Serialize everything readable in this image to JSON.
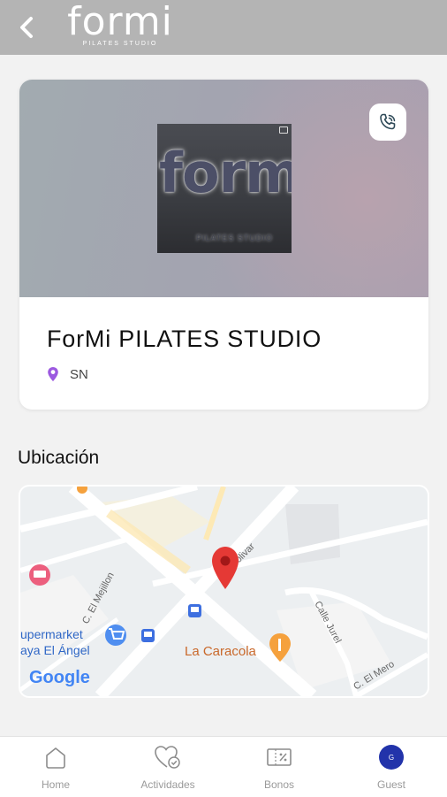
{
  "header": {
    "back_icon": "chevron-left-icon",
    "logo_word": "formi",
    "logo_sub": "PILATES STUDIO"
  },
  "studio": {
    "photo_word": "formi",
    "photo_sub": "PILATES STUDIO",
    "call_icon": "phone-call-icon",
    "name": "ForMi PILATES STUDIO",
    "location_icon": "location-pin-icon",
    "location": "SN",
    "accent_color": "#9c59e0"
  },
  "location_section": {
    "title": "Ubicación"
  },
  "map": {
    "labels": {
      "street_bolivar": "Bolivar",
      "street_mejillon": "C. El Mejillon",
      "street_jurel": "Calle Jurel",
      "street_mero": "C. El Mero",
      "supermarket_line1": "upermarket",
      "supermarket_line2": "aya El Ángel",
      "restaurant": "La Caracola",
      "google": "Google"
    },
    "pin_color": "#e53935"
  },
  "nav": {
    "items": [
      {
        "label": "Home",
        "icon": "home-icon"
      },
      {
        "label": "Actividades",
        "icon": "heart-check-icon"
      },
      {
        "label": "Bonos",
        "icon": "coupon-icon"
      },
      {
        "label": "Guest",
        "icon": "avatar-icon",
        "initial": "G"
      }
    ]
  }
}
